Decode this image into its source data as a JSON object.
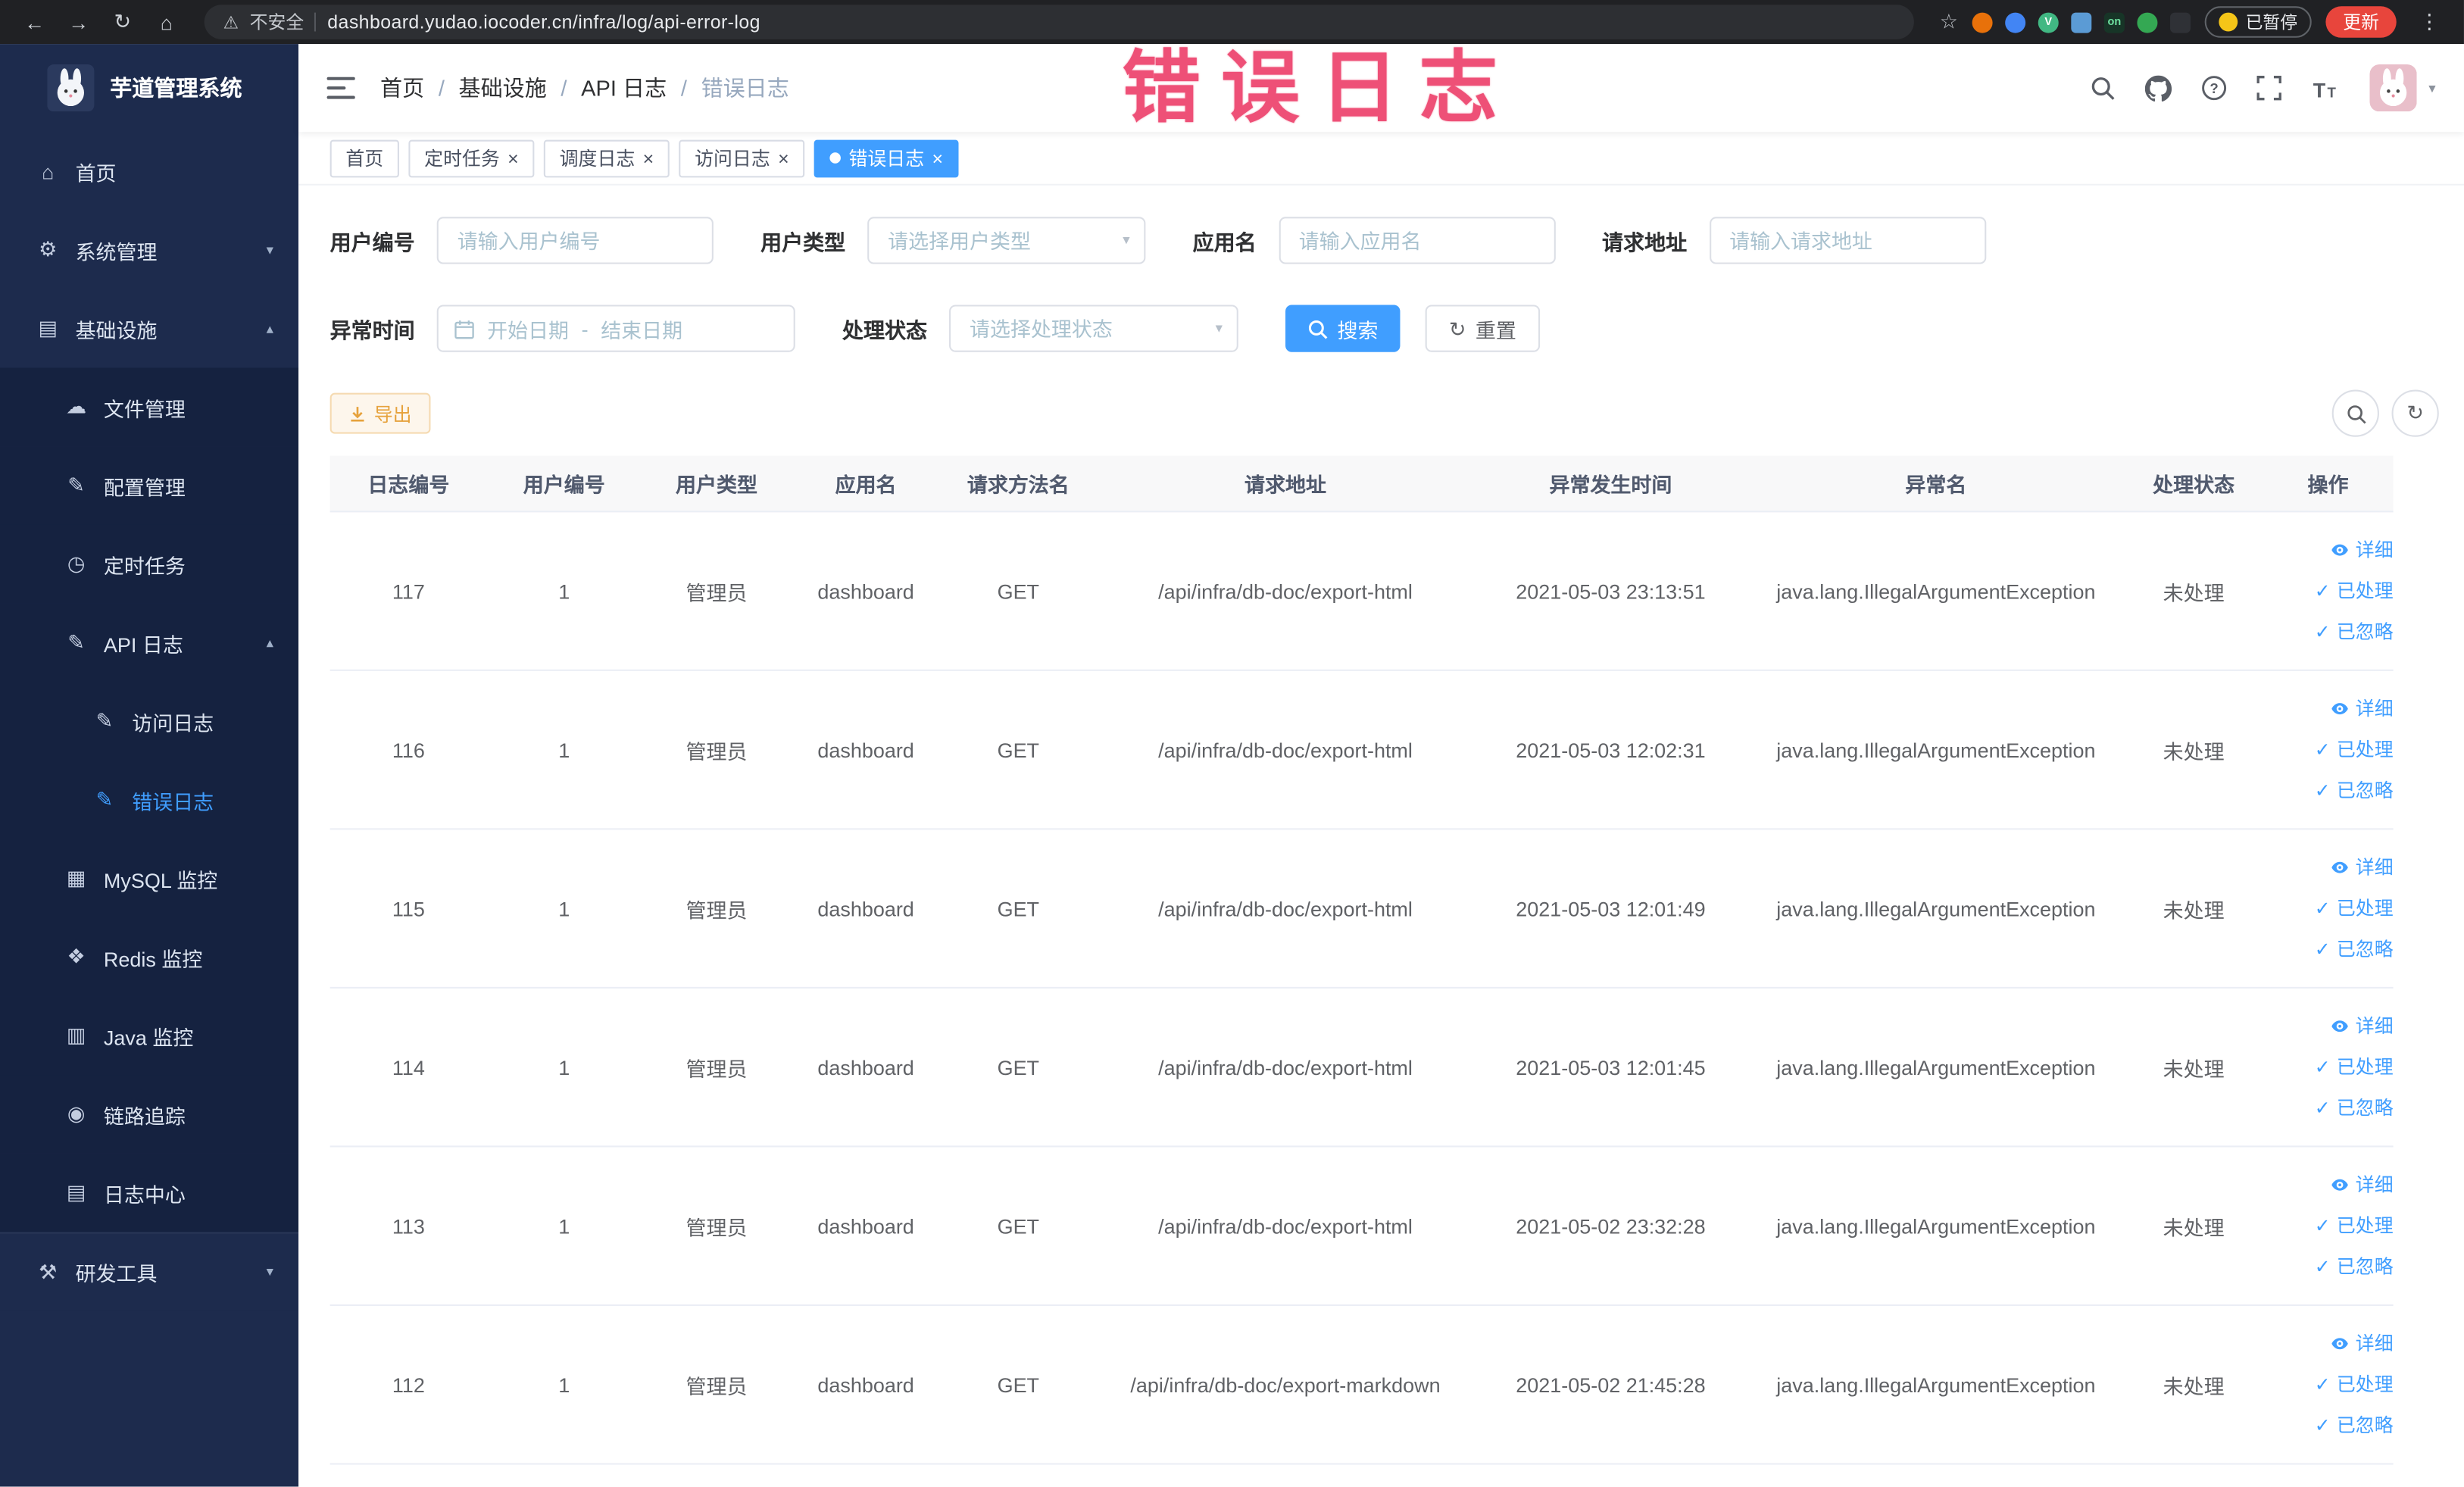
{
  "annotation": "错误日志",
  "browser": {
    "security_label": "不安全",
    "url": "dashboard.yudao.iocoder.cn/infra/log/api-error-log",
    "paused_badge": "已暂停",
    "update_button": "更新",
    "extensions": [
      {
        "name": "extension-orange",
        "color": "#e8710a",
        "text": "",
        "square": false
      },
      {
        "name": "extension-blue-drop",
        "color": "#4285f4",
        "text": "",
        "square": false
      },
      {
        "name": "extension-vue-devtools",
        "color": "#41b883",
        "text": "V",
        "square": false
      },
      {
        "name": "extension-grid",
        "color": "#5b9bd5",
        "text": "",
        "square": true
      },
      {
        "name": "extension-on-badge",
        "color": "#173527",
        "text": "on",
        "square": true
      },
      {
        "name": "extension-green",
        "color": "#34a853",
        "text": "",
        "square": false
      },
      {
        "name": "extension-dark",
        "color": "#2f3136",
        "text": "",
        "square": true
      }
    ]
  },
  "glyphs": {
    "back": "←",
    "forward": "→",
    "reload": "↻",
    "home": "⌂",
    "warning": "⚠",
    "star": "☆",
    "kebab": "⋮",
    "close": "×",
    "caret": "▾",
    "chevron_up": "▴",
    "chevron_down": "▾",
    "check": "✓",
    "refresh": "↻",
    "range_sep": "-"
  },
  "sidebar": {
    "logo_title": "芋道管理系统",
    "items": [
      {
        "label": "首页",
        "icon": "home",
        "glyph": "⌂",
        "depth": 0
      },
      {
        "label": "系统管理",
        "icon": "system-gear",
        "glyph": "⚙",
        "depth": 0,
        "arrow": "down"
      },
      {
        "label": "基础设施",
        "icon": "infrastructure",
        "glyph": "▤",
        "depth": 0,
        "arrow": "up"
      },
      {
        "label": "文件管理",
        "icon": "file-manage",
        "glyph": "☁",
        "depth": 1
      },
      {
        "label": "配置管理",
        "icon": "config-manage",
        "glyph": "✎",
        "depth": 1
      },
      {
        "label": "定时任务",
        "icon": "scheduled-task",
        "glyph": "◷",
        "depth": 1
      },
      {
        "label": "API 日志",
        "icon": "api-log",
        "glyph": "✎",
        "depth": 1,
        "arrow": "up"
      },
      {
        "label": "访问日志",
        "icon": "access-log",
        "glyph": "✎",
        "depth": 2
      },
      {
        "label": "错误日志",
        "icon": "error-log",
        "glyph": "✎",
        "depth": 2,
        "active": true
      },
      {
        "label": "MySQL 监控",
        "icon": "mysql-monitor",
        "glyph": "▦",
        "depth": 1
      },
      {
        "label": "Redis 监控",
        "icon": "redis-monitor",
        "glyph": "❖",
        "depth": 1
      },
      {
        "label": "Java 监控",
        "icon": "java-monitor",
        "glyph": "▥",
        "depth": 1
      },
      {
        "label": "链路追踪",
        "icon": "trace",
        "glyph": "◉",
        "depth": 1
      },
      {
        "label": "日志中心",
        "icon": "log-center",
        "glyph": "▤",
        "depth": 1
      },
      {
        "label": "研发工具",
        "icon": "dev-tools",
        "glyph": "⚒",
        "depth": 0,
        "arrow": "down",
        "variant": "footer"
      }
    ]
  },
  "breadcrumb": [
    "首页",
    "基础设施",
    "API 日志",
    "错误日志"
  ],
  "tabs": [
    {
      "label": "首页",
      "active": false,
      "closable": false
    },
    {
      "label": "定时任务",
      "active": false,
      "closable": true
    },
    {
      "label": "调度日志",
      "active": false,
      "closable": true
    },
    {
      "label": "访问日志",
      "active": false,
      "closable": true
    },
    {
      "label": "错误日志",
      "active": true,
      "closable": true
    }
  ],
  "filters": {
    "user_id": {
      "label": "用户编号",
      "placeholder": "请输入用户编号"
    },
    "user_type": {
      "label": "用户类型",
      "placeholder": "请选择用户类型"
    },
    "app_name": {
      "label": "应用名",
      "placeholder": "请输入应用名"
    },
    "request_url": {
      "label": "请求地址",
      "placeholder": "请输入请求地址"
    },
    "exception_time": {
      "label": "异常时间",
      "start_placeholder": "开始日期",
      "end_placeholder": "结束日期"
    },
    "process_status": {
      "label": "处理状态",
      "placeholder": "请选择处理状态"
    },
    "search_label": "搜索",
    "reset_label": "重置"
  },
  "toolbar": {
    "export_label": "导出"
  },
  "table": {
    "columns": [
      "日志编号",
      "用户编号",
      "用户类型",
      "应用名",
      "请求方法名",
      "请求地址",
      "异常发生时间",
      "异常名",
      "处理状态",
      "操作"
    ],
    "actions": [
      {
        "label": "详细",
        "name": "detail",
        "icon": "eye-icon"
      },
      {
        "label": "已处理",
        "name": "processed",
        "icon": "check-icon"
      },
      {
        "label": "已忽略",
        "name": "ignore",
        "icon": "check-icon"
      }
    ],
    "rows": [
      [
        "117",
        "1",
        "管理员",
        "dashboard",
        "GET",
        "/api/infra/db-doc/export-html",
        "2021-05-03 23:13:51",
        "java.lang.IllegalArgumentException",
        "未处理"
      ],
      [
        "116",
        "1",
        "管理员",
        "dashboard",
        "GET",
        "/api/infra/db-doc/export-html",
        "2021-05-03 12:02:31",
        "java.lang.IllegalArgumentException",
        "未处理"
      ],
      [
        "115",
        "1",
        "管理员",
        "dashboard",
        "GET",
        "/api/infra/db-doc/export-html",
        "2021-05-03 12:01:49",
        "java.lang.IllegalArgumentException",
        "未处理"
      ],
      [
        "114",
        "1",
        "管理员",
        "dashboard",
        "GET",
        "/api/infra/db-doc/export-html",
        "2021-05-03 12:01:45",
        "java.lang.IllegalArgumentException",
        "未处理"
      ],
      [
        "113",
        "1",
        "管理员",
        "dashboard",
        "GET",
        "/api/infra/db-doc/export-html",
        "2021-05-02 23:32:28",
        "java.lang.IllegalArgumentException",
        "未处理"
      ],
      [
        "112",
        "1",
        "管理员",
        "dashboard",
        "GET",
        "/api/infra/db-doc/export-markdown",
        "2021-05-02 21:45:28",
        "java.lang.IllegalArgumentException",
        "未处理"
      ]
    ]
  }
}
